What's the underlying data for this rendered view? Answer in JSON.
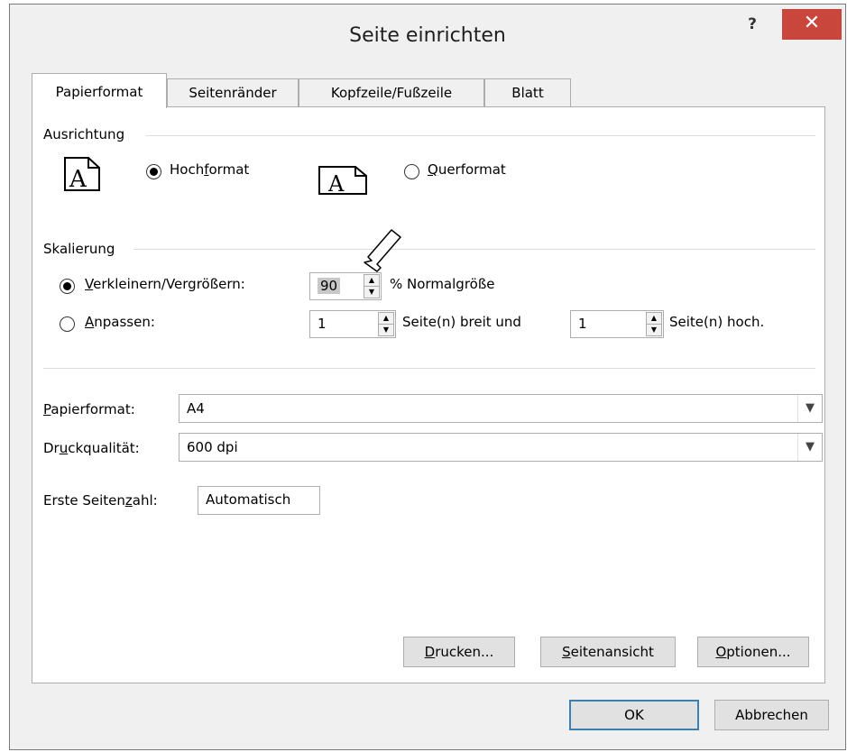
{
  "window": {
    "title": "Seite einrichten",
    "help_label": "?",
    "close_label": "✕"
  },
  "tabs": [
    {
      "label": "Papierformat"
    },
    {
      "label": "Seitenränder"
    },
    {
      "label": "Kopfzeile/Fußzeile"
    },
    {
      "label": "Blatt"
    }
  ],
  "orientation": {
    "group_label": "Ausrichtung",
    "portrait": {
      "pre": "Hoch",
      "mnemonic": "f",
      "post": "ormat",
      "selected": true,
      "icon_letter": "A"
    },
    "landscape": {
      "pre": "",
      "mnemonic": "Q",
      "post": "uerformat",
      "selected": false,
      "icon_letter": "A"
    }
  },
  "scaling": {
    "group_label": "Skalierung",
    "adjust": {
      "mnemonic": "V",
      "post": "erkleinern/Vergrößern:",
      "selected": true,
      "value": "90",
      "suffix": "% Normalgröße"
    },
    "fit": {
      "mnemonic": "A",
      "post": "npassen:",
      "selected": false,
      "wide_value": "1",
      "wide_suffix": "Seite(n) breit und",
      "tall_value": "1",
      "tall_suffix": "Seite(n) hoch."
    }
  },
  "paper": {
    "size_label_mnemonic": "P",
    "size_label_post": "apierformat:",
    "size_value": "A4",
    "quality_label_pre": "Dr",
    "quality_label_mnemonic": "u",
    "quality_label_post": "ckqualität:",
    "quality_value": "600 dpi",
    "first_page_label_pre": "Erste Seiten",
    "first_page_label_mnemonic": "z",
    "first_page_label_post": "ahl:",
    "first_page_value": "Automatisch"
  },
  "panel_buttons": [
    {
      "mnemonic": "D",
      "post": "rucken..."
    },
    {
      "mnemonic": "S",
      "post": "eitenansicht"
    },
    {
      "mnemonic": "O",
      "post": "ptionen..."
    }
  ],
  "footer": {
    "ok_label": "OK",
    "cancel_label": "Abbrechen"
  }
}
